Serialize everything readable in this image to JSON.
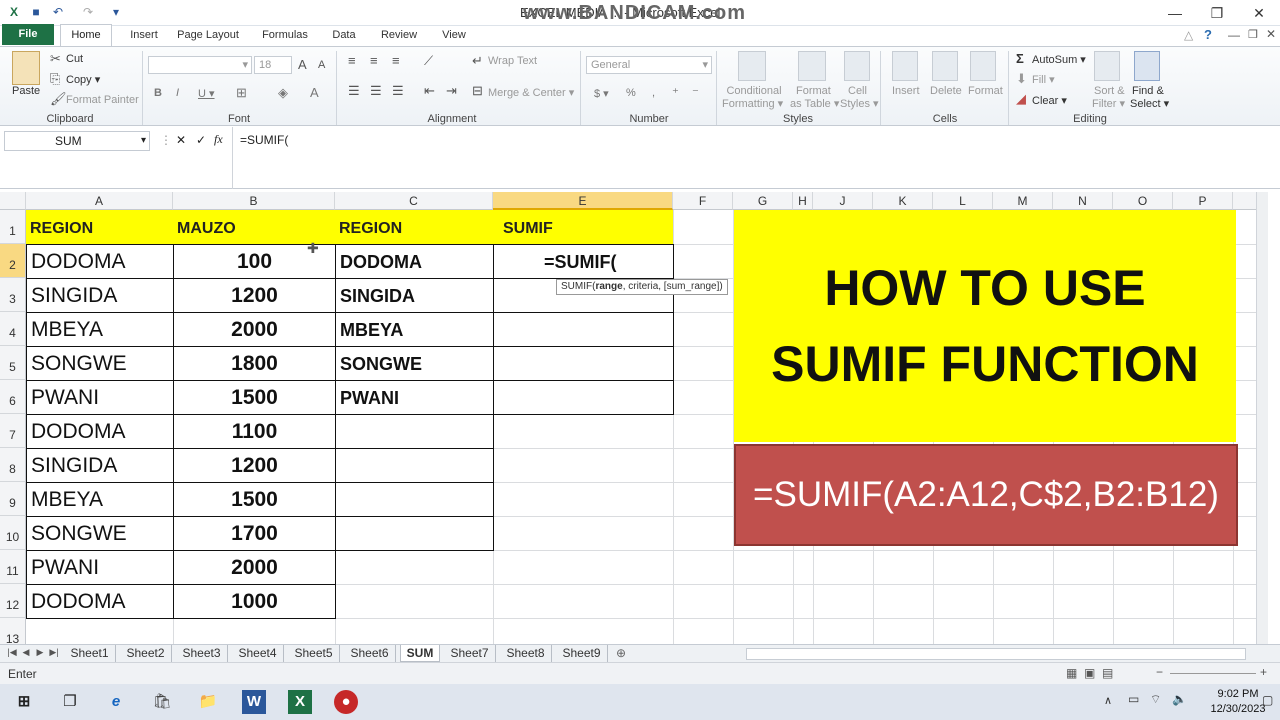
{
  "window": {
    "title": "EXCEL MEDIA ... - Microsoft Excel",
    "watermark": "www.BANDICAM.com",
    "controls": {
      "minimize": "—",
      "restore": "❐",
      "close": "✕"
    }
  },
  "ribbon_tabs": [
    "File",
    "Home",
    "Insert",
    "Page Layout",
    "Formulas",
    "Data",
    "Review",
    "View"
  ],
  "clipboard": {
    "paste": "Paste",
    "cut": "Cut",
    "copy": "Copy ▾",
    "format_painter": "Format Painter",
    "label": "Clipboard"
  },
  "font": {
    "size": "18",
    "bold": "B",
    "italic": "I",
    "underline": "U ▾",
    "label": "Font"
  },
  "alignment": {
    "wrap": "Wrap Text",
    "merge": "Merge & Center ▾",
    "label": "Alignment"
  },
  "number": {
    "format": "General",
    "currency": "$ ▾",
    "percent": "%",
    "comma": ",",
    "label": "Number"
  },
  "styles": {
    "conditional": [
      "Conditional",
      "Formatting ▾"
    ],
    "table": [
      "Format",
      "as Table ▾"
    ],
    "cell": [
      "Cell",
      "Styles ▾"
    ],
    "label": "Styles"
  },
  "cells": {
    "insert": "Insert",
    "delete": "Delete",
    "format": "Format",
    "label": "Cells"
  },
  "editing": {
    "autosum": "AutoSum ▾",
    "fill": "Fill ▾",
    "clear": "Clear ▾",
    "sort": [
      "Sort &",
      "Filter ▾"
    ],
    "find": [
      "Find &",
      "Select ▾"
    ],
    "label": "Editing"
  },
  "formula_bar": {
    "name_box": "SUM",
    "formula": "=SUMIF(",
    "cancel": "✕",
    "enter": "✓",
    "fx": "fx"
  },
  "columns": [
    "A",
    "B",
    "C",
    "E",
    "F",
    "G",
    "H",
    "J",
    "K",
    "L",
    "M",
    "N",
    "O",
    "P"
  ],
  "rows": [
    "1",
    "2",
    "3",
    "4",
    "5",
    "6",
    "7",
    "8",
    "9",
    "10",
    "11",
    "12",
    "13"
  ],
  "sheet": {
    "headers": {
      "a": "REGION",
      "b": "MAUZO",
      "c": "REGION",
      "e": "SUMIF"
    },
    "data": [
      {
        "region": "DODOMA",
        "mauzo": "100"
      },
      {
        "region": "SINGIDA",
        "mauzo": "1200"
      },
      {
        "region": "MBEYA",
        "mauzo": "2000"
      },
      {
        "region": "SONGWE",
        "mauzo": "1800"
      },
      {
        "region": "PWANI",
        "mauzo": "1500"
      },
      {
        "region": "DODOMA",
        "mauzo": "1100"
      },
      {
        "region": "SINGIDA",
        "mauzo": "1200"
      },
      {
        "region": "MBEYA",
        "mauzo": "1500"
      },
      {
        "region": "SONGWE",
        "mauzo": "1700"
      },
      {
        "region": "PWANI",
        "mauzo": "2000"
      },
      {
        "region": "DODOMA",
        "mauzo": "1000"
      }
    ],
    "criteria": [
      "DODOMA",
      "SINGIDA",
      "MBEYA",
      "SONGWE",
      "PWANI"
    ],
    "editing_cell": "=SUMIF(",
    "tooltip": {
      "fn": "SUMIF(",
      "arg1": "range",
      "rest": ", criteria, [sum_range])"
    }
  },
  "banner": {
    "line1": "HOW TO USE",
    "line2": "SUMIF FUNCTION",
    "formula": "=SUMIF(A2:A12,C$2,B2:B12)"
  },
  "sheet_tabs": [
    "Sheet1",
    "Sheet2",
    "Sheet3",
    "Sheet4",
    "Sheet5",
    "Sheet6",
    "SUM",
    "Sheet7",
    "Sheet8",
    "Sheet9"
  ],
  "active_sheet": "SUM",
  "status": "Enter",
  "clock": {
    "time": "9:02 PM",
    "date": "12/30/2023"
  },
  "colors": {
    "excel_green": "#1e7145",
    "header_yellow": "#ffff00",
    "banner_red": "#c0504d"
  }
}
